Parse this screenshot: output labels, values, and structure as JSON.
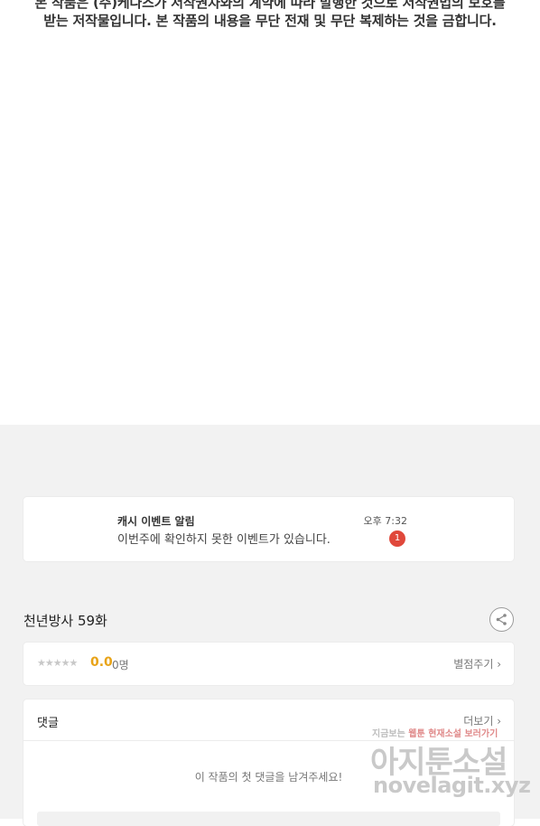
{
  "notice": {
    "line1": "본 작품은 (주)케나즈가 저작권자와의 계약에 따라 발행한 것으로 저작권법의 보호를",
    "line2": "받는 저작물입니다. 본 작품의 내용을 무단 전재 및 무단 복제하는 것을 금합니다."
  },
  "promo": {
    "title": "캐시 이벤트 알림",
    "message": "이번주에 확인하지 못한 이벤트가 있습니다.",
    "time": "오후 7:32",
    "badge": "1"
  },
  "episode": {
    "title": "천년방사 59화"
  },
  "rating": {
    "stars": "★★★★★",
    "score": "0.0",
    "count": "0명",
    "rate_label": "별점주기 ›"
  },
  "comments": {
    "title": "댓글",
    "more_label": "더보기 ›",
    "empty_message": "이 작품의 첫 댓글을 남겨주세요!"
  },
  "watermark": {
    "tagline_a": "지금보는",
    "tagline_b": "웹툰",
    "tagline_c": "현재소설",
    "tagline_d": "보러가기",
    "brand": "아지툰소설",
    "url": "novelagit.xyz"
  }
}
